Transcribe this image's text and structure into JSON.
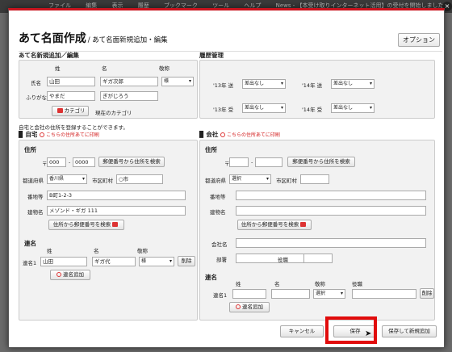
{
  "background_tabs": [
    "ファイル",
    "編集",
    "表示",
    "履歴",
    "ブックマーク",
    "ツール",
    "ヘルプ",
    "News - 【本受け取りインターネット活用】の受付を開始しました"
  ],
  "dialog": {
    "title": "あて名面作成",
    "subtitle": "/ あて名面新規追加・編集",
    "option_button": "オプション",
    "close": "×"
  },
  "address_section": {
    "title": "あて名新規追加／編集",
    "col_sei": "姓",
    "col_mei": "名",
    "col_title": "敬称",
    "row_name_label": "氏名",
    "row_furigana_label": "ふりがな",
    "sei": "山田",
    "mei": "ギガ次郎",
    "title_value": "様",
    "sei_kana": "やまだ",
    "mei_kana": "ぎがじろう",
    "category_button": "カテゴリ",
    "category_value": "現在のカテゴリ"
  },
  "history_section": {
    "title": "履歴管理",
    "rows": [
      {
        "year": "'13",
        "kind": "年 送",
        "value": "差出なし"
      },
      {
        "year": "'14",
        "kind": "年 送",
        "value": "差出なし"
      },
      {
        "year": "'13",
        "kind": "年 受",
        "value": "差出なし"
      },
      {
        "year": "'14",
        "kind": "年 受",
        "value": "差出なし"
      }
    ]
  },
  "note": "自宅と会社の住所を登録することができます。",
  "home": {
    "heading": "自宅",
    "radio": "こちらの住所あてに印刷",
    "address_title": "住所",
    "postal_mark": "〒",
    "zip1": "000",
    "zip2": "0000",
    "zip_search": "郵便番号から住所を検索",
    "pref_label": "都道府県",
    "pref": "香川県",
    "city_label": "市区町村",
    "city": "○市",
    "street_label": "番地等",
    "street": "B町1-2-3",
    "building_label": "建物名",
    "building": "メゾンド・ギガ 111",
    "addr_search": "住所から郵便番号を検索",
    "joint_title": "連名",
    "joint_col_sei": "姓",
    "joint_col_mei": "名",
    "joint_col_title": "敬称",
    "joint_row_label": "連名1",
    "joint_sei": "山田",
    "joint_mei": "ギガ代",
    "joint_title_value": "様",
    "delete": "削除",
    "add": "連名追加"
  },
  "company": {
    "heading": "会社",
    "radio": "こちらの住所あてに印刷",
    "address_title": "住所",
    "postal_mark": "〒",
    "zip_search": "郵便番号から住所を検索",
    "pref_label": "都道府県",
    "pref": "選択",
    "city_label": "市区町村",
    "street_label": "番地等",
    "building_label": "建物名",
    "addr_search": "住所から郵便番号を検索",
    "company_label": "会社名",
    "dept_label": "部署",
    "position_label": "役職",
    "joint_title": "連名",
    "joint_col_sei": "姓",
    "joint_col_mei": "名",
    "joint_col_title": "敬称",
    "joint_col_position": "役職",
    "joint_row_label": "連名1",
    "joint_title_value": "選択",
    "delete": "削除",
    "add": "連名追加"
  },
  "footer": {
    "cancel": "キャンセル",
    "save": "保存",
    "save_and_add": "保存して新規追加"
  },
  "colors": {
    "accent_red": "#c8141e",
    "highlight": "#e10c0c"
  }
}
